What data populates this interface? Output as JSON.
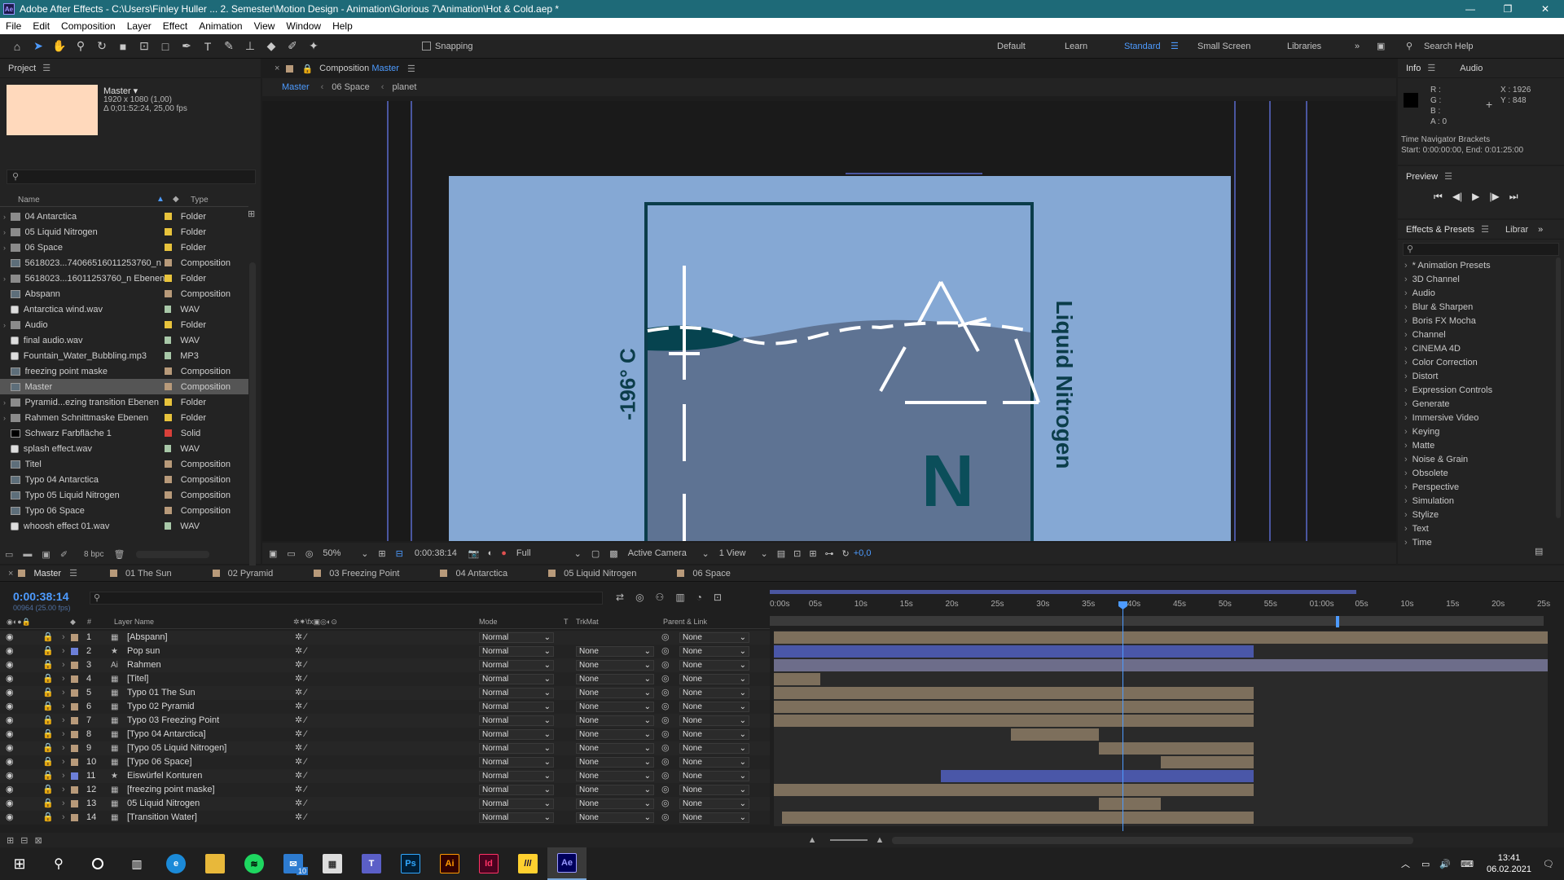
{
  "window": {
    "title": "Adobe After Effects - C:\\Users\\Finley Huller ... 2. Semester\\Motion Design - Animation\\Glorious 7\\Animation\\Hot & Cold.aep *",
    "app_icon": "Ae",
    "controls": [
      "—",
      "❐",
      "✕"
    ]
  },
  "menu": [
    "File",
    "Edit",
    "Composition",
    "Layer",
    "Effect",
    "Animation",
    "View",
    "Window",
    "Help"
  ],
  "toolbar": {
    "snapping": "Snapping",
    "workspaces": [
      "Default",
      "Learn",
      "Standard",
      "Small Screen",
      "Libraries"
    ],
    "active_workspace": "Standard",
    "search": "Search Help"
  },
  "project": {
    "tab": "Project",
    "preview_name": "Master ▾",
    "preview_info1": "1920 x 1080 (1,00)",
    "preview_info2": "Δ 0;01:52:24, 25,00 fps",
    "col_name": "Name",
    "col_type": "Type",
    "bpc": "8 bpc",
    "items": [
      {
        "name": "04 Antarctica",
        "type": "Folder",
        "kind": "folder",
        "label": "#e8c33c",
        "arrow": "›"
      },
      {
        "name": "05 Liquid Nitrogen",
        "type": "Folder",
        "kind": "folder",
        "label": "#e8c33c",
        "arrow": "›"
      },
      {
        "name": "06 Space",
        "type": "Folder",
        "kind": "folder",
        "label": "#e8c33c",
        "arrow": "›"
      },
      {
        "name": "5618023...74066516011253760_n",
        "type": "Composition",
        "kind": "comp",
        "label": "#b89a7a",
        "arrow": ""
      },
      {
        "name": "5618023...16011253760_n Ebenen",
        "type": "Folder",
        "kind": "folder",
        "label": "#e8c33c",
        "arrow": "›"
      },
      {
        "name": "Abspann",
        "type": "Composition",
        "kind": "comp",
        "label": "#b89a7a",
        "arrow": ""
      },
      {
        "name": "Antarctica wind.wav",
        "type": "WAV",
        "kind": "wav",
        "label": "#a8c8a8",
        "arrow": ""
      },
      {
        "name": "Audio",
        "type": "Folder",
        "kind": "folder",
        "label": "#e8c33c",
        "arrow": "›"
      },
      {
        "name": "final audio.wav",
        "type": "WAV",
        "kind": "wav",
        "label": "#a8c8a8",
        "arrow": ""
      },
      {
        "name": "Fountain_Water_Bubbling.mp3",
        "type": "MP3",
        "kind": "wav",
        "label": "#a8c8a8",
        "arrow": ""
      },
      {
        "name": "freezing point maske",
        "type": "Composition",
        "kind": "comp",
        "label": "#b89a7a",
        "arrow": ""
      },
      {
        "name": "Master",
        "type": "Composition",
        "kind": "comp",
        "label": "#b89a7a",
        "arrow": "",
        "sel": true
      },
      {
        "name": "Pyramid...ezing transition Ebenen",
        "type": "Folder",
        "kind": "folder",
        "label": "#e8c33c",
        "arrow": "›"
      },
      {
        "name": "Rahmen Schnittmaske Ebenen",
        "type": "Folder",
        "kind": "folder",
        "label": "#e8c33c",
        "arrow": "›"
      },
      {
        "name": "Schwarz Farbfläche 1",
        "type": "Solid",
        "kind": "solid",
        "label": "#d9403a",
        "arrow": ""
      },
      {
        "name": "splash effect.wav",
        "type": "WAV",
        "kind": "wav",
        "label": "#a8c8a8",
        "arrow": ""
      },
      {
        "name": "Titel",
        "type": "Composition",
        "kind": "comp",
        "label": "#b89a7a",
        "arrow": ""
      },
      {
        "name": "Typo 04 Antarctica",
        "type": "Composition",
        "kind": "comp",
        "label": "#b89a7a",
        "arrow": ""
      },
      {
        "name": "Typo 05 Liquid Nitrogen",
        "type": "Composition",
        "kind": "comp",
        "label": "#b89a7a",
        "arrow": ""
      },
      {
        "name": "Typo 06 Space",
        "type": "Composition",
        "kind": "comp",
        "label": "#b89a7a",
        "arrow": ""
      },
      {
        "name": "whoosh effect 01.wav",
        "type": "WAV",
        "kind": "wav",
        "label": "#a8c8a8",
        "arrow": ""
      }
    ]
  },
  "composition": {
    "tab_prefix": "Composition",
    "tab_name": "Master",
    "breadcrumbs": [
      "Master",
      "06 Space",
      "planet"
    ],
    "artwork": {
      "temp": "-196° C",
      "title": "Liquid Nitrogen",
      "symbol": "N"
    },
    "footer": {
      "zoom": "50%",
      "time": "0:00:38:14",
      "resolution": "Full",
      "camera": "Active Camera",
      "views": "1 View",
      "exposure": "+0,0"
    }
  },
  "info": {
    "tabs": [
      "Info",
      "Audio"
    ],
    "r": "R :",
    "g": "G :",
    "b": "B :",
    "a": "A : 0",
    "x": "X : 1926",
    "y": "Y : 848",
    "bracket_title": "Time Navigator Brackets",
    "bracket_range": "Start: 0:00:00:00, End: 0:01:25:00"
  },
  "preview": {
    "title": "Preview"
  },
  "effects": {
    "tab": "Effects & Presets",
    "tab2": "Librar",
    "items": [
      "* Animation Presets",
      "3D Channel",
      "Audio",
      "Blur & Sharpen",
      "Boris FX Mocha",
      "Channel",
      "CINEMA 4D",
      "Color Correction",
      "Distort",
      "Expression Controls",
      "Generate",
      "Immersive Video",
      "Keying",
      "Matte",
      "Noise & Grain",
      "Obsolete",
      "Perspective",
      "Simulation",
      "Stylize",
      "Text",
      "Time"
    ]
  },
  "timeline": {
    "tabs": [
      {
        "name": "Master",
        "color": "#b89a7a",
        "active": true
      },
      {
        "name": "01 The Sun",
        "color": "#b89a7a"
      },
      {
        "name": "02 Pyramid",
        "color": "#b89a7a"
      },
      {
        "name": "03 Freezing Point",
        "color": "#b89a7a"
      },
      {
        "name": "04 Antarctica",
        "color": "#b89a7a"
      },
      {
        "name": "05 Liquid Nitrogen",
        "color": "#b89a7a"
      },
      {
        "name": "06 Space",
        "color": "#b89a7a"
      }
    ],
    "time": "0:00:38:14",
    "frames": "00964 (25.00 fps)",
    "headers": {
      "layer": "Layer Name",
      "mode": "Mode",
      "t": "T",
      "trkmat": "TrkMat",
      "parent": "Parent & Link"
    },
    "ruler": [
      "0:00s",
      "05s",
      "10s",
      "15s",
      "20s",
      "25s",
      "30s",
      "35s",
      "40s",
      "45s",
      "50s",
      "55s",
      "01:00s",
      "05s",
      "10s",
      "15s",
      "20s",
      "25s"
    ],
    "layers": [
      {
        "num": "1",
        "name": "[Abspann]",
        "icon": "comp",
        "label": "#b89a7a",
        "mode": "Normal",
        "trk": "",
        "parent": "None",
        "bar": [
          0,
          1
        ],
        "barc": "#7d6f5c"
      },
      {
        "num": "2",
        "name": "Pop sun",
        "icon": "star",
        "label": "#6c7fd8",
        "mode": "Normal",
        "trk": "None",
        "parent": "None",
        "bar": [
          0,
          0.62
        ],
        "barc": "#4a57a8"
      },
      {
        "num": "3",
        "name": "Rahmen",
        "icon": "ai",
        "label": "#b89a7a",
        "mode": "Normal",
        "trk": "None",
        "parent": "None",
        "bar": [
          0,
          1
        ],
        "barc": "#6d6d8a"
      },
      {
        "num": "4",
        "name": "[Titel]",
        "icon": "comp",
        "label": "#b89a7a",
        "mode": "Normal",
        "trk": "None",
        "parent": "None",
        "bar": [
          0,
          0.06
        ],
        "barc": "#7d6f5c"
      },
      {
        "num": "5",
        "name": "Typo 01 The Sun",
        "icon": "comp",
        "label": "#b89a7a",
        "mode": "Normal",
        "trk": "None",
        "parent": "None",
        "bar": [
          0,
          0.62
        ],
        "barc": "#7d6f5c"
      },
      {
        "num": "6",
        "name": "Typo 02 Pyramid",
        "icon": "comp",
        "label": "#b89a7a",
        "mode": "Normal",
        "trk": "None",
        "parent": "None",
        "bar": [
          0,
          0.62
        ],
        "barc": "#7d6f5c"
      },
      {
        "num": "7",
        "name": "Typo 03 Freezing Point",
        "icon": "comp",
        "label": "#b89a7a",
        "mode": "Normal",
        "trk": "None",
        "parent": "None",
        "bar": [
          0,
          0.62
        ],
        "barc": "#7d6f5c"
      },
      {
        "num": "8",
        "name": "[Typo 04 Antarctica]",
        "icon": "comp",
        "label": "#b89a7a",
        "mode": "Normal",
        "trk": "None",
        "parent": "None",
        "bar": [
          0.306,
          0.42
        ],
        "barc": "#7d6f5c"
      },
      {
        "num": "9",
        "name": "[Typo 05 Liquid Nitrogen]",
        "icon": "comp",
        "label": "#b89a7a",
        "mode": "Normal",
        "trk": "None",
        "parent": "None",
        "bar": [
          0.42,
          0.62
        ],
        "barc": "#7d6f5c"
      },
      {
        "num": "10",
        "name": "[Typo 06 Space]",
        "icon": "comp",
        "label": "#b89a7a",
        "mode": "Normal",
        "trk": "None",
        "parent": "None",
        "bar": [
          0.5,
          0.62
        ],
        "barc": "#7d6f5c"
      },
      {
        "num": "11",
        "name": "Eiswürfel Konturen",
        "icon": "star",
        "label": "#6c7fd8",
        "mode": "Normal",
        "trk": "None",
        "parent": "None",
        "bar": [
          0.216,
          0.62
        ],
        "barc": "#4a57a8"
      },
      {
        "num": "12",
        "name": "[freezing point maske]",
        "icon": "comp",
        "label": "#b89a7a",
        "mode": "Normal",
        "trk": "None",
        "parent": "None",
        "bar": [
          0,
          0.62
        ],
        "barc": "#7d6f5c"
      },
      {
        "num": "13",
        "name": "05 Liquid Nitrogen",
        "icon": "comp",
        "label": "#b89a7a",
        "mode": "Normal",
        "trk": "None",
        "parent": "None",
        "bar": [
          0.42,
          0.5
        ],
        "barc": "#7d6f5c"
      },
      {
        "num": "14",
        "name": "[Transition Water]",
        "icon": "comp",
        "label": "#b89a7a",
        "mode": "Normal",
        "trk": "None",
        "parent": "None",
        "bar": [
          0.01,
          0.62
        ],
        "barc": "#7d6f5c"
      }
    ]
  },
  "taskbar": {
    "time": "13:41",
    "date": "06.02.2021",
    "mail_badge": "10",
    "apps": [
      "Ps",
      "Ai",
      "Id",
      "Ae"
    ]
  }
}
